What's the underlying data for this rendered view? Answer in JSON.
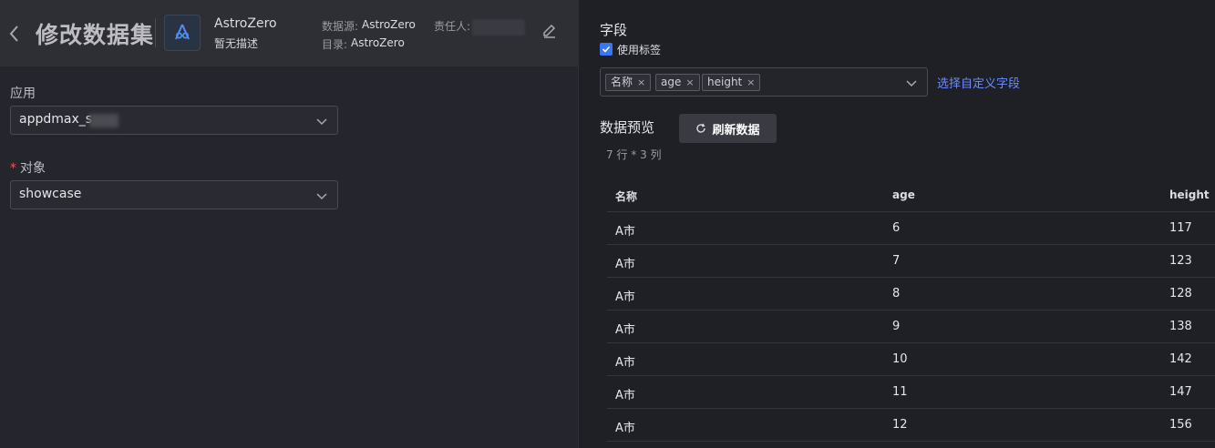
{
  "header": {
    "title": "修改数据集",
    "app_name": "AstroZero",
    "app_desc": "暂无描述",
    "datasource_label": "数据源:",
    "datasource_value": "AstroZero",
    "owner_label": "责任人:",
    "catalog_label": "目录:",
    "catalog_value": "AstroZero"
  },
  "form": {
    "app_label": "应用",
    "app_value": "appdmax_s",
    "object_required": "*",
    "object_label": "对象",
    "object_value": "showcase"
  },
  "fields": {
    "title": "字段",
    "use_tags_label": "使用标签",
    "use_tags_checked": true,
    "tags": [
      "名称",
      "age",
      "height"
    ],
    "custom_link": "选择自定义字段"
  },
  "preview": {
    "title": "数据预览",
    "refresh_label": "刷新数据",
    "dims": "7 行 * 3 列",
    "columns": [
      "名称",
      "age",
      "height"
    ],
    "rows": [
      [
        "A市",
        "6",
        "117"
      ],
      [
        "A市",
        "7",
        "123"
      ],
      [
        "A市",
        "8",
        "128"
      ],
      [
        "A市",
        "9",
        "138"
      ],
      [
        "A市",
        "10",
        "142"
      ],
      [
        "A市",
        "11",
        "147"
      ],
      [
        "A市",
        "12",
        "156"
      ]
    ]
  },
  "colors": {
    "accent": "#3a76f0",
    "link": "#6b8cff"
  },
  "icons": [
    "back-icon",
    "app-logo-icon",
    "edit-icon",
    "chevron-down-icon",
    "check-icon",
    "close-icon",
    "refresh-icon"
  ]
}
